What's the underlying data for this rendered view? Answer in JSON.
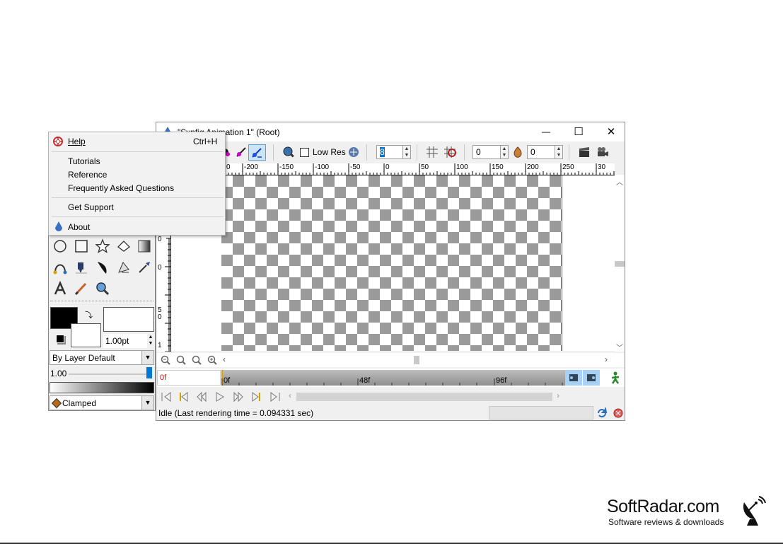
{
  "window": {
    "title": "\"Synfig Animation 1\" (Root)",
    "minimize": "—",
    "maximize": "☐",
    "close": "✕"
  },
  "toolbar": {
    "low_res_label": "Low Res",
    "low_res_checked": false,
    "spin_value": "8",
    "past_onion": "0",
    "future_onion": "0"
  },
  "ruler": {
    "h_ticks": [
      "0",
      "-200",
      "-150",
      "-100",
      "-50",
      "0",
      "50",
      "100",
      "150",
      "200",
      "250",
      "30"
    ],
    "v_ticks": [
      "0",
      "0",
      "5",
      "0",
      "1"
    ]
  },
  "timebar": {
    "current_time": "0f",
    "marks": [
      "0f",
      "48f",
      "96f"
    ]
  },
  "status": {
    "text": "Idle (Last rendering time = 0.094331 sec)"
  },
  "toolbox": {
    "outline_width": "1.00pt",
    "blend_method": "By Layer Default",
    "opacity": "1.00",
    "interpolation": "Clamped"
  },
  "help_menu": {
    "items": [
      {
        "label": "Help",
        "shortcut": "Ctrl+H",
        "icon": "lifebuoy-icon"
      },
      {
        "label": "Tutorials"
      },
      {
        "label": "Reference"
      },
      {
        "label": "Frequently Asked Questions"
      },
      {
        "label": "Get Support"
      },
      {
        "label": "About",
        "icon": "synfig-logo-icon"
      }
    ]
  },
  "watermark": {
    "title": "SoftRadar.com",
    "subtitle": "Software reviews & downloads"
  },
  "colors": {
    "accent": "#0078d7",
    "checker_dark": "#9a9a9a",
    "time_red": "#dd0000"
  }
}
